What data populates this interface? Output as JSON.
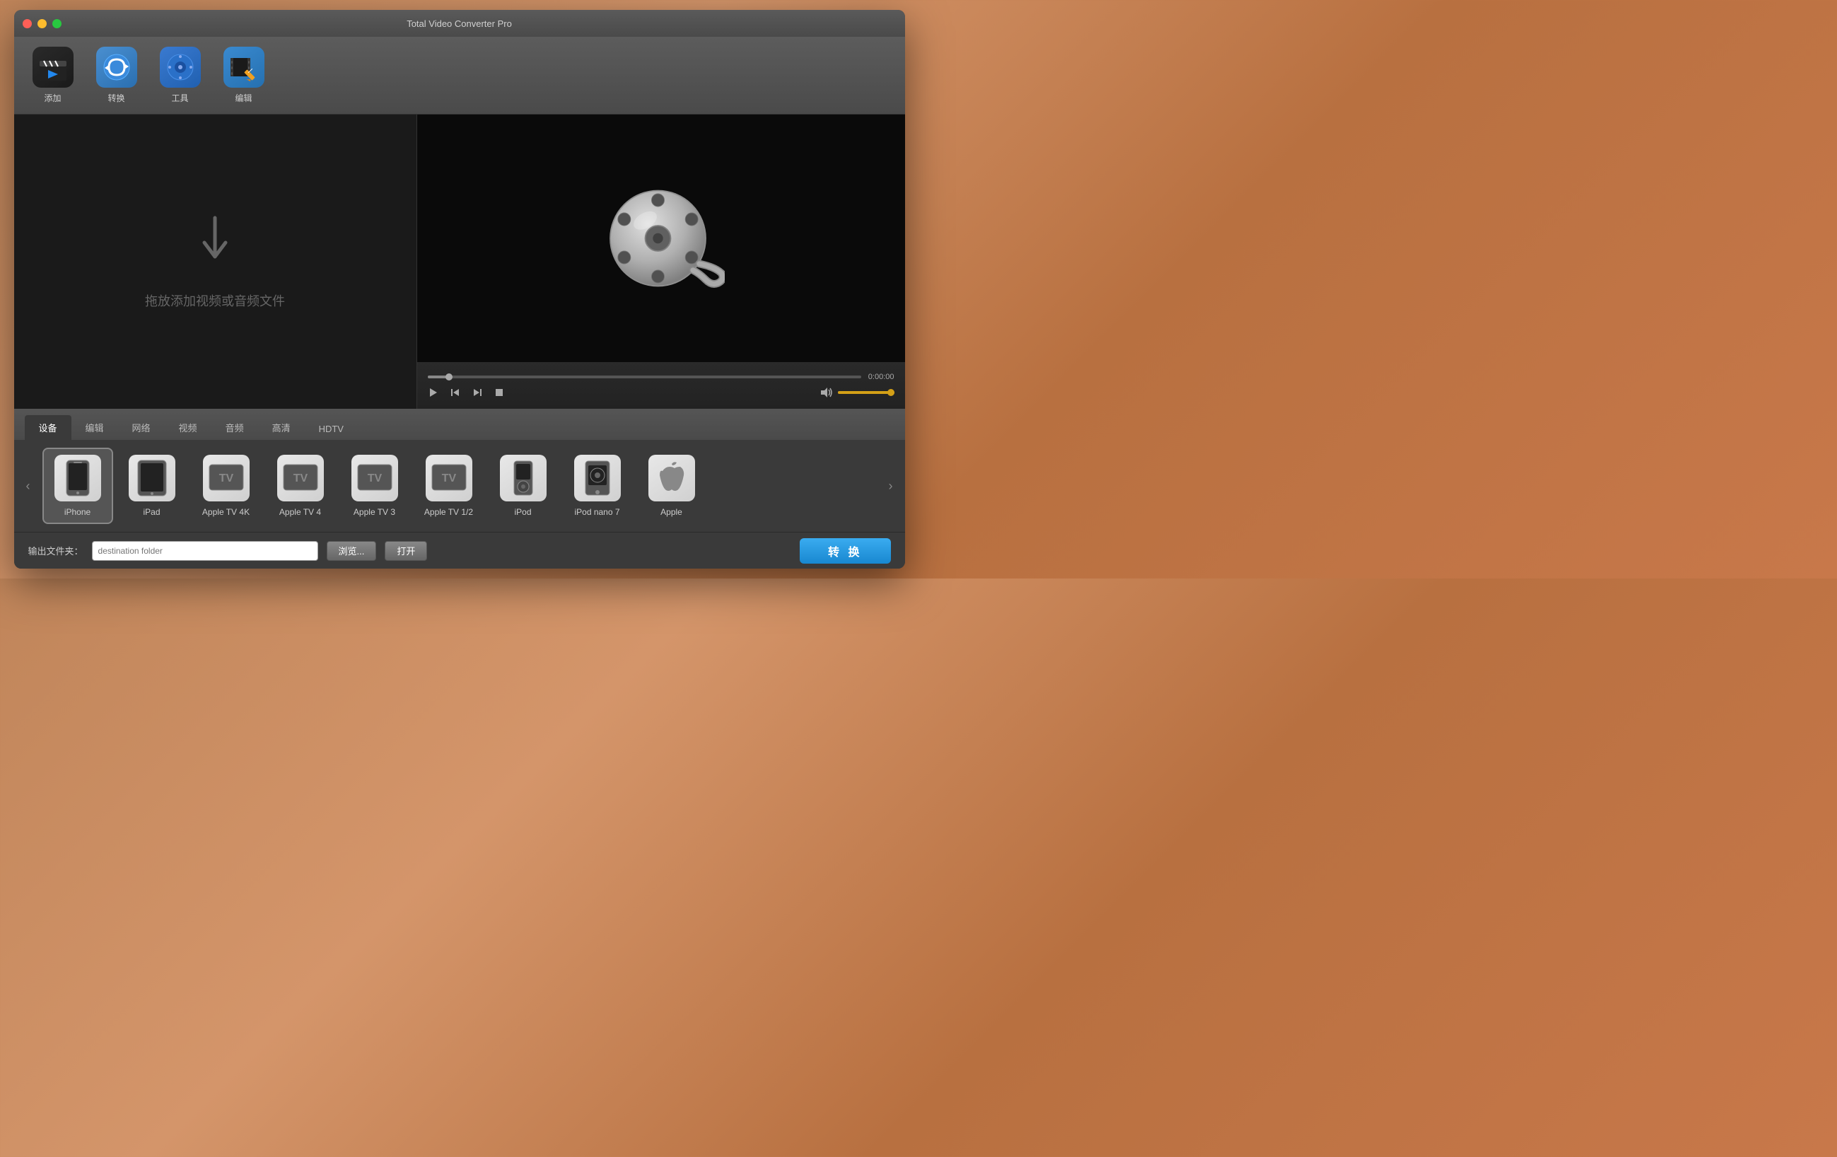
{
  "window": {
    "title": "Total Video Converter Pro"
  },
  "toolbar": {
    "add_label": "添加",
    "convert_label": "转换",
    "tools_label": "工具",
    "edit_label": "编辑"
  },
  "left_panel": {
    "drop_text": "拖放添加视频或音频文件"
  },
  "video_controls": {
    "time": "0:00:00"
  },
  "tabs": [
    {
      "label": "设备",
      "active": true
    },
    {
      "label": "编辑",
      "active": false
    },
    {
      "label": "网络",
      "active": false
    },
    {
      "label": "视频",
      "active": false
    },
    {
      "label": "音频",
      "active": false
    },
    {
      "label": "高清",
      "active": false
    },
    {
      "label": "HDTV",
      "active": false
    }
  ],
  "devices": [
    {
      "label": "iPhone",
      "icon": "📱",
      "selected": true
    },
    {
      "label": "iPad",
      "icon": "📲",
      "selected": false
    },
    {
      "label": "Apple TV 4K",
      "icon": "TV",
      "selected": false
    },
    {
      "label": "Apple TV 4",
      "icon": "TV",
      "selected": false
    },
    {
      "label": "Apple TV 3",
      "icon": "TV",
      "selected": false
    },
    {
      "label": "Apple TV 1/2",
      "icon": "TV",
      "selected": false
    },
    {
      "label": "iPod",
      "icon": "🎵",
      "selected": false
    },
    {
      "label": "iPod nano 7",
      "icon": "⊙",
      "selected": false
    },
    {
      "label": "Apple",
      "icon": "",
      "selected": false
    }
  ],
  "output": {
    "label": "输出文件夹：",
    "placeholder": "destination folder",
    "browse_label": "浏览...",
    "open_label": "打开",
    "convert_label": "转 换"
  }
}
